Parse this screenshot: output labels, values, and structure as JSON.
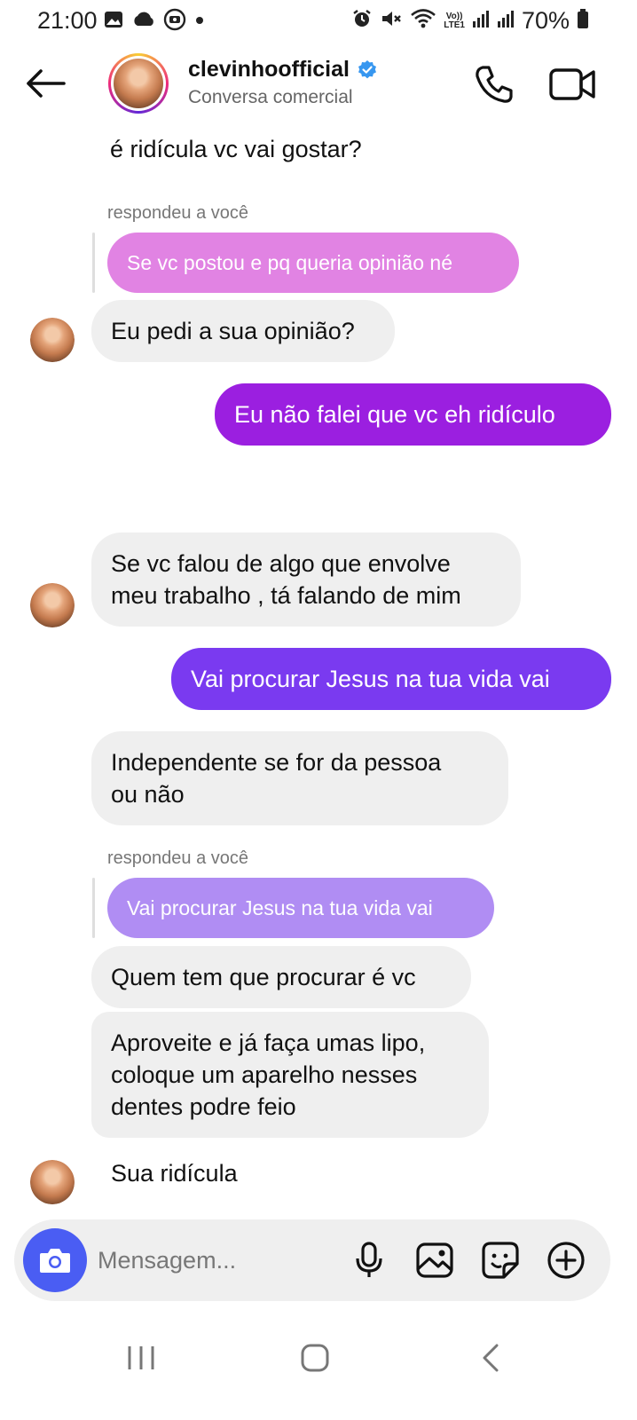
{
  "status_bar": {
    "time": "21:00",
    "battery": "70%",
    "left_icons": [
      "image-icon",
      "cloud-icon",
      "screen-record-icon",
      "dot-icon"
    ],
    "right_icons": [
      "alarm-icon",
      "mute-icon",
      "wifi-icon",
      "volte-icon",
      "signal-icon",
      "signal-icon",
      "battery-icon"
    ],
    "volte_text_top": "Vo))",
    "volte_text_bottom": "LTE1"
  },
  "header": {
    "name": "clevinhoofficial",
    "subtitle": "Conversa comercial",
    "verified": true,
    "icons": [
      "back-arrow-icon",
      "verified-badge-icon",
      "phone-icon",
      "video-camera-icon"
    ]
  },
  "messages": [
    {
      "id": "m1",
      "direction": "in",
      "text": "é ridícula vc vai gostar?",
      "partial": true
    },
    {
      "id": "m2",
      "direction": "in",
      "reply_label": "respondeu a você",
      "reply_quote": "Se vc postou e pq queria opinião né",
      "text": "Eu pedi a sua opinião?"
    },
    {
      "id": "m3",
      "direction": "out",
      "text": "Eu não falei que vc eh ridículo"
    },
    {
      "id": "m4",
      "direction": "in",
      "lines": [
        "Se vc falou de algo que envolve",
        "meu trabalho , tá falando de mim"
      ]
    },
    {
      "id": "m5",
      "direction": "out",
      "text": "Vai procurar Jesus na tua vida vai"
    },
    {
      "id": "m6",
      "direction": "in",
      "lines": [
        "Independente se for da pessoa",
        "ou não"
      ]
    },
    {
      "id": "m7",
      "direction": "in",
      "reply_label": "respondeu a você",
      "reply_quote": "Vai procurar Jesus na tua vida vai",
      "text": "Quem tem que procurar é vc"
    },
    {
      "id": "m8",
      "direction": "in",
      "lines": [
        "Aproveite e já faça umas lipo,",
        "coloque um aparelho nesses",
        "dentes podre feio"
      ]
    },
    {
      "id": "m9",
      "direction": "in",
      "text": "Sua ridícula"
    }
  ],
  "composer": {
    "placeholder": "Mensagem...",
    "icons": [
      "camera-icon",
      "microphone-icon",
      "gallery-icon",
      "sticker-icon",
      "plus-icon"
    ]
  },
  "nav": {
    "icons": [
      "recent-apps-icon",
      "home-icon",
      "back-icon"
    ]
  },
  "colors": {
    "outgoing_1": "#9b1fe0",
    "outgoing_2": "#7a3af0",
    "quote_1": "#e183e3",
    "quote_2": "#b08df3",
    "incoming": "#efefef",
    "camera_button": "#4a5df3",
    "verified": "#3797f0"
  }
}
